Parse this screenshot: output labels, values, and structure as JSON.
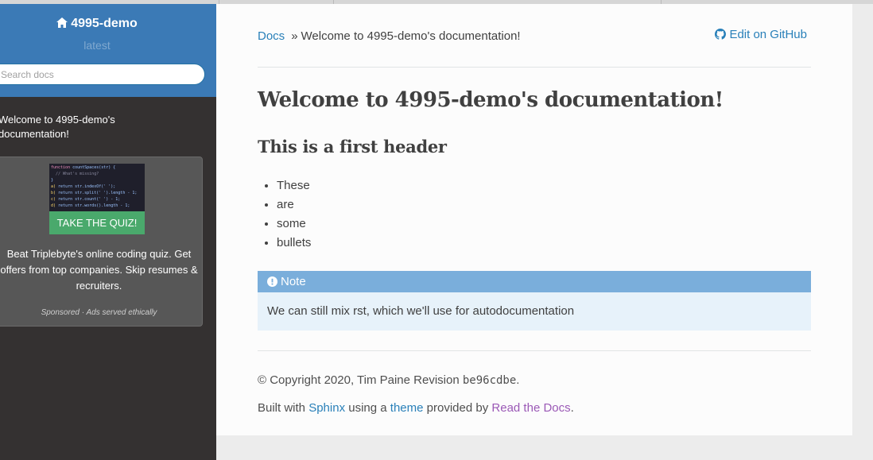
{
  "sidebar": {
    "project_title": "4995-demo",
    "version": "latest",
    "search_placeholder": "Search docs",
    "nav_link": "Welcome to 4995-demo's documentation!",
    "ad": {
      "button_label": "TAKE THE QUIZ!",
      "text": "Beat Triplebyte's online coding quiz. Get offers from top companies. Skip resumes & recruiters.",
      "sponsor": "Sponsored · Ads served ethically"
    }
  },
  "breadcrumb": {
    "home": "Docs",
    "separator": "»",
    "current": "Welcome to 4995-demo's documentation!"
  },
  "edit_link": "Edit on GitHub",
  "page": {
    "title": "Welcome to 4995-demo's documentation!",
    "subtitle": "This is a first header",
    "bullets": [
      "These",
      "are",
      "some",
      "bullets"
    ]
  },
  "note": {
    "title": "Note",
    "body": "We can still mix rst, which we'll use for autodocumentation"
  },
  "footer": {
    "copyright": "© Copyright 2020, Tim Paine Revision",
    "revision": "be96cdbe",
    "builtwith_prefix": "Built with",
    "sphinx": "Sphinx",
    "using_a": "using a",
    "theme": "theme",
    "provided_by": "provided by",
    "rtd": "Read the Docs"
  },
  "colors": {
    "sidebar_top": "#3b7ab6",
    "sidebar": "#343131",
    "link": "#2980b9",
    "note_title": "#7aaedb",
    "note_body": "#e7f2fa",
    "quiz_button": "#4aa96c"
  }
}
